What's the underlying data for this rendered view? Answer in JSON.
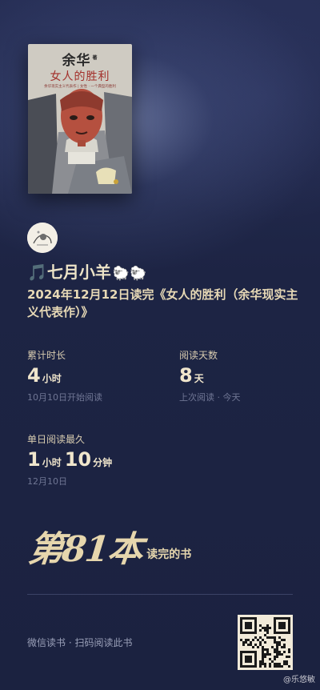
{
  "book": {
    "cover_author": "余华",
    "cover_author_suffix": "著",
    "cover_title": "女人的胜利",
    "cover_subtitle": "余华现实主义代表作 | 女性 · 一个典型的胜利"
  },
  "user": {
    "name": "🎵七月小羊",
    "sheep": "🐑🐑"
  },
  "headline": "2024年12月12日读完《女人的胜利（余华现实主义代表作）》",
  "stats": {
    "total_time": {
      "label": "累计时长",
      "value": "4",
      "unit": "小时",
      "sub": "10月10日开始阅读"
    },
    "days": {
      "label": "阅读天数",
      "value": "8",
      "unit": "天",
      "sub": "上次阅读 · 今天"
    },
    "longest_day": {
      "label": "单日阅读最久",
      "value1": "1",
      "unit1": "小时",
      "value2": "10",
      "unit2": "分钟",
      "sub": "12月10日"
    }
  },
  "ordinal": {
    "big": "第81本",
    "small": "读完的书"
  },
  "footer": {
    "text": "微信读书 · 扫码阅读此书"
  },
  "watermark": "@乐悠敏",
  "colors": {
    "background": "#1d2444",
    "gold_text": "#e9dcc0",
    "muted": "#6f7694"
  }
}
